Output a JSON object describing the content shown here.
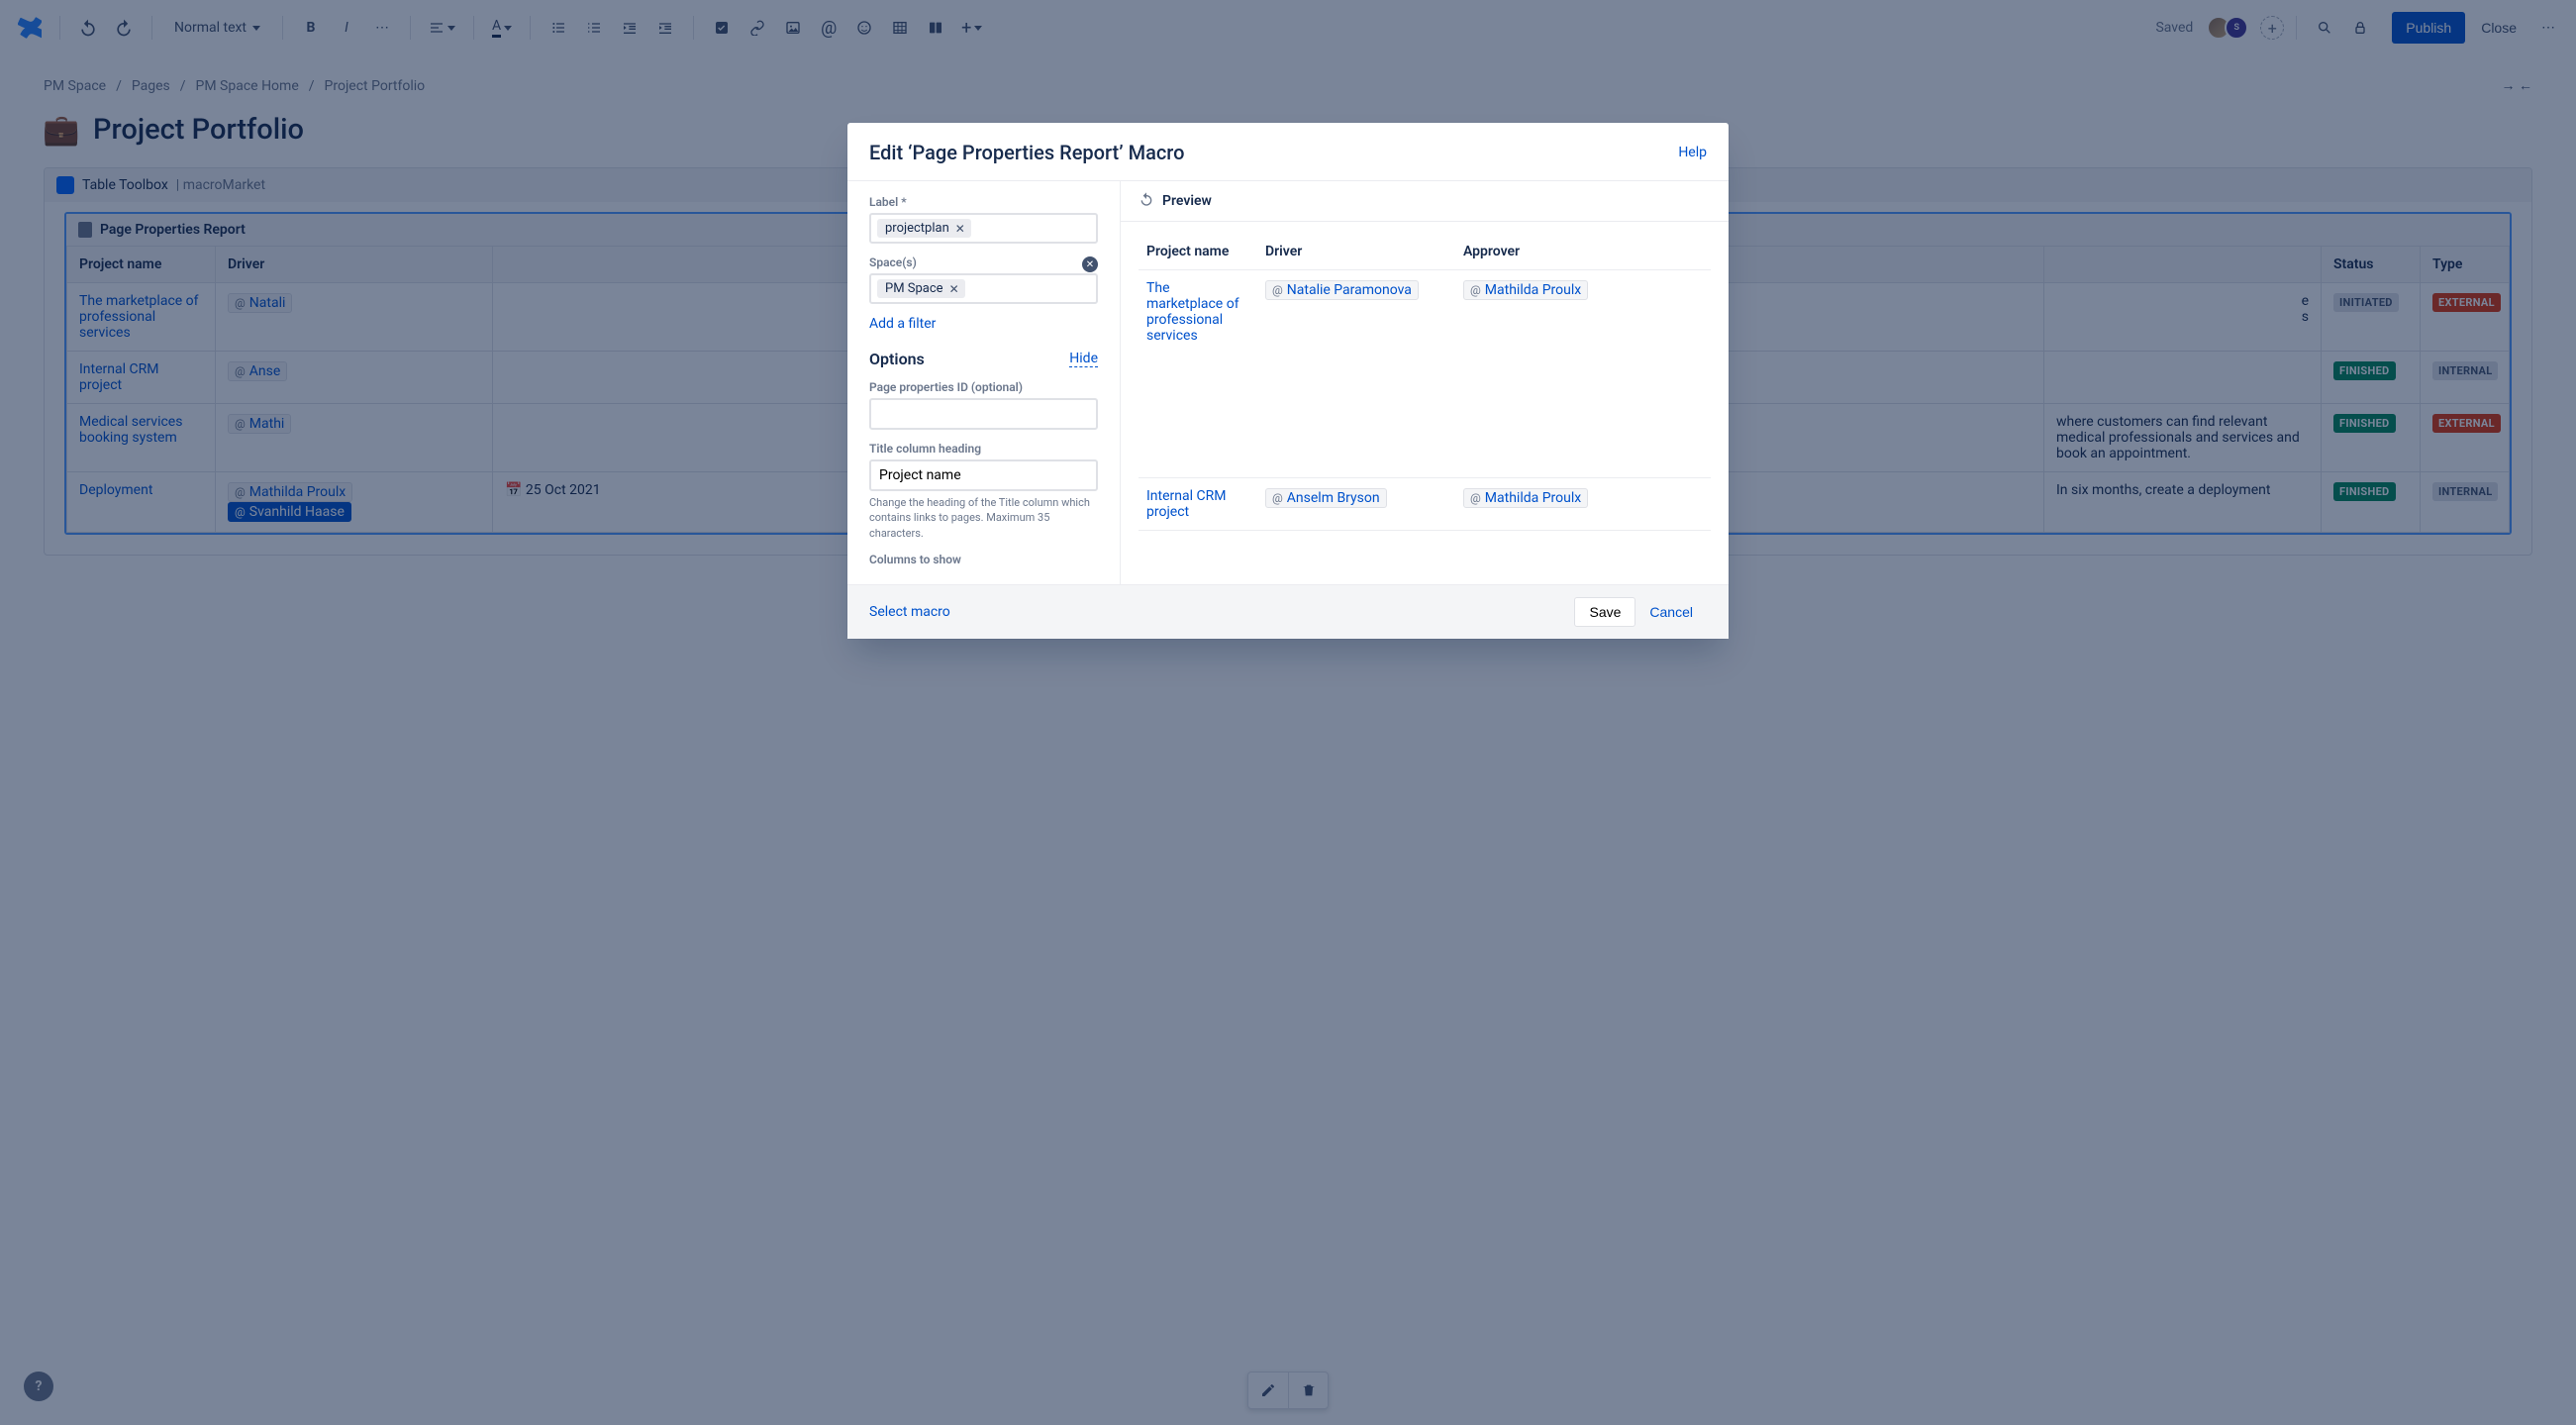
{
  "toolbar": {
    "text_style": "Normal text",
    "saved": "Saved",
    "publish": "Publish",
    "close": "Close"
  },
  "breadcrumb": {
    "items": [
      "PM Space",
      "Pages",
      "PM Space Home",
      "Project Portfolio"
    ]
  },
  "page": {
    "emoji": "💼",
    "title": "Project Portfolio"
  },
  "macro_outer": {
    "title": "Table Toolbox",
    "suffix": " | macroMarket"
  },
  "macro_inner": {
    "title": "Page Properties Report"
  },
  "report_table": {
    "columns": [
      "Project name",
      "Driver",
      "Status",
      "Type"
    ],
    "rows": [
      {
        "name": "The marketplace of professional services",
        "driver": "Natali",
        "desc_peek": "",
        "status": "INITIATED",
        "status_class": "status-initiated",
        "type": "EXTERNAL",
        "type_class": "type-external"
      },
      {
        "name": "Internal CRM project",
        "driver": "Anse",
        "desc_peek": "",
        "status": "FINISHED",
        "status_class": "status-finished",
        "type": "INTERNAL",
        "type_class": "type-internal"
      },
      {
        "name": "Medical services booking system",
        "driver": "Mathi",
        "desc_peek": "where customers can find relevant medical professionals and services and book an appointment.",
        "status": "FINISHED",
        "status_class": "status-finished",
        "type": "EXTERNAL",
        "type_class": "type-external"
      },
      {
        "name": "Deployment",
        "driver": "Mathilda Proulx",
        "assignee": "Svanhild Haase",
        "date": "25 Oct 2021",
        "desc_peek": "In six months, create a deployment",
        "status": "FINISHED",
        "status_class": "status-finished",
        "type": "INTERNAL",
        "type_class": "type-internal"
      }
    ]
  },
  "modal": {
    "title": "Edit ‘Page Properties Report’ Macro",
    "help": "Help",
    "labels": {
      "label_field": "Label *",
      "space_field": "Space(s)",
      "add_filter": "Add a filter",
      "options": "Options",
      "hide": "Hide",
      "page_props_id": "Page properties ID (optional)",
      "title_col_heading": "Title column heading",
      "title_col_hint": "Change the heading of the Title column which contains links to pages. Maximum 35 characters.",
      "columns_to_show": "Columns to show"
    },
    "values": {
      "label_tag": "projectplan",
      "space_tag": "PM Space",
      "page_props_id": "",
      "title_col_heading": "Project name"
    },
    "preview": {
      "title": "Preview",
      "columns": [
        "Project name",
        "Driver",
        "Approver"
      ],
      "rows": [
        {
          "name": "The marketplace of professional services",
          "driver": "Natalie Paramonova",
          "approver": "Mathilda Proulx"
        },
        {
          "name": "Internal CRM project",
          "driver": "Anselm Bryson",
          "approver": "Mathilda Proulx"
        }
      ]
    },
    "footer": {
      "select_macro": "Select macro",
      "save": "Save",
      "cancel": "Cancel"
    }
  }
}
